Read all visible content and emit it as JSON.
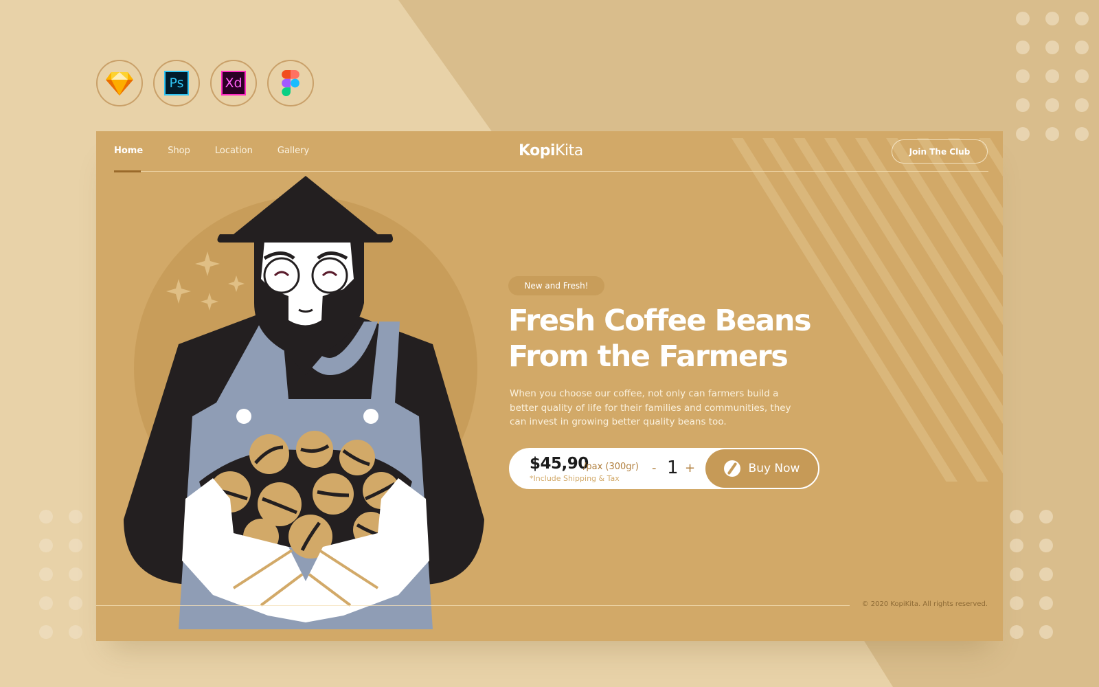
{
  "tools": [
    {
      "name": "Sketch",
      "icon": "sketch-icon"
    },
    {
      "name": "Photoshop",
      "label": "Ps",
      "icon": "photoshop-icon"
    },
    {
      "name": "Adobe XD",
      "label": "Xd",
      "icon": "xd-icon"
    },
    {
      "name": "Figma",
      "icon": "figma-icon"
    }
  ],
  "nav": {
    "items": [
      {
        "label": "Home",
        "active": true
      },
      {
        "label": "Shop"
      },
      {
        "label": "Location"
      },
      {
        "label": "Gallery"
      }
    ]
  },
  "brand": {
    "bold": "Kopi",
    "light": "Kita"
  },
  "join_button": "Join The Club",
  "hero": {
    "badge": "New and Fresh!",
    "title_line1": "Fresh Coffee Beans",
    "title_line2": "From the Farmers",
    "description": "When you choose our coffee, not only can farmers build a better quality of life for their families and communities, they can invest in growing better quality beans too."
  },
  "purchase": {
    "price": "$45,90",
    "unit": "/pax (300gr)",
    "note": "*Include Shipping & Tax",
    "minus": "-",
    "quantity": "1",
    "plus": "+",
    "buy_label": "Buy Now"
  },
  "footer": {
    "copyright": "© 2020 KopiKita. All rights reserved."
  },
  "colors": {
    "card": "#d2a968",
    "background": "#e8d2a8",
    "accent": "#c69a57",
    "dark": "#231f20",
    "apron": "#8f9db5"
  }
}
